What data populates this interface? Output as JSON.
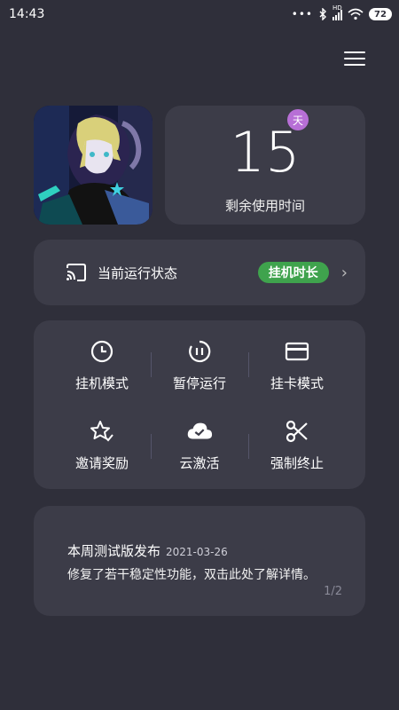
{
  "status_bar": {
    "time": "14:43",
    "signal_text": "HD",
    "battery": "72"
  },
  "menu": {
    "icon": "hamburger-menu-icon"
  },
  "avatar": {
    "description_icon": "avatar-image"
  },
  "remaining": {
    "days": "15",
    "unit_badge": "天",
    "label": "剩余使用时间"
  },
  "run_status": {
    "label": "当前运行状态",
    "tag": "挂机时长",
    "tag_color": "#3fa34d",
    "icon": "cast-icon"
  },
  "actions": [
    {
      "label": "挂机模式",
      "icon": "clock-icon"
    },
    {
      "label": "暂停运行",
      "icon": "pause-circle-icon"
    },
    {
      "label": "挂卡模式",
      "icon": "card-icon"
    },
    {
      "label": "邀请奖励",
      "icon": "star-check-icon"
    },
    {
      "label": "云激活",
      "icon": "cloud-check-icon"
    },
    {
      "label": "强制终止",
      "icon": "scissors-icon"
    }
  ],
  "notice": {
    "title": "本周测试版发布",
    "date": "2021-03-26",
    "body": "修复了若干稳定性功能，双击此处了解详情。",
    "page": "1/2"
  },
  "colors": {
    "background": "#2f2f3a",
    "card": "#3c3c48",
    "badge": "#b76fd6"
  }
}
